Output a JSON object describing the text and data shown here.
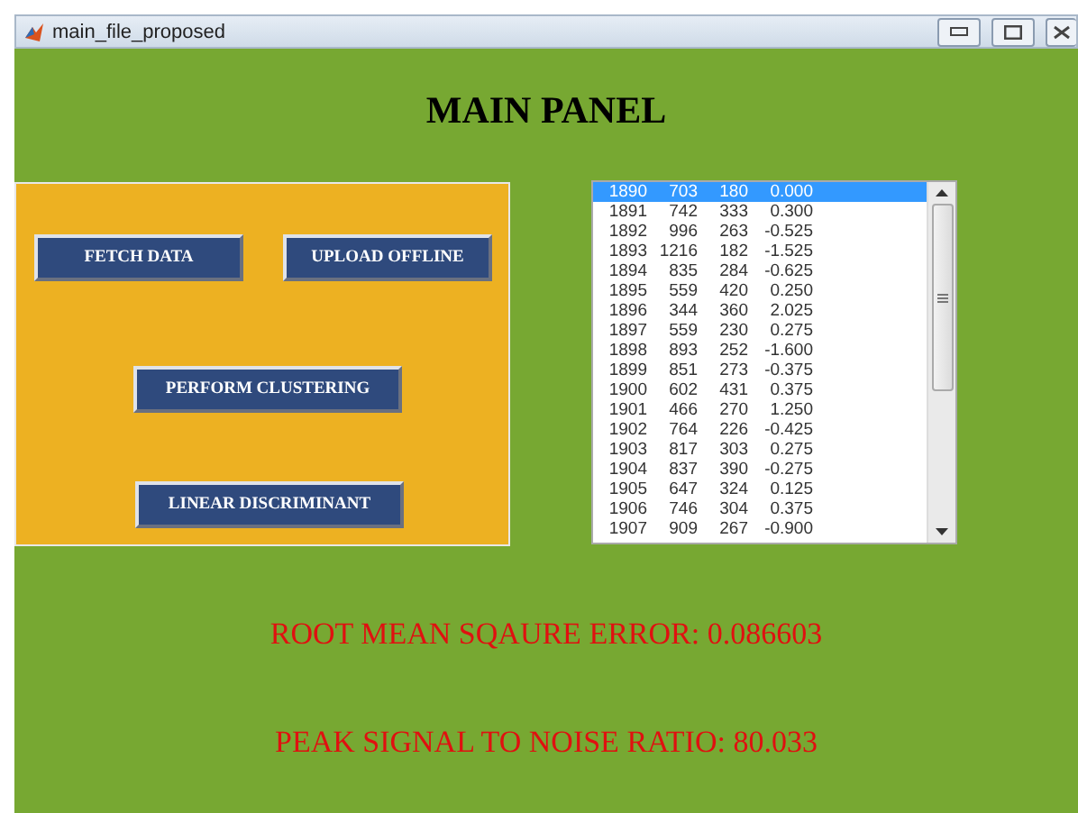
{
  "window": {
    "title": "main_file_proposed"
  },
  "heading": "MAIN PANEL",
  "buttons": [
    "FETCH DATA",
    "UPLOAD OFFLINE",
    "PERFORM CLUSTERING",
    "LINEAR DISCRIMINANT"
  ],
  "list": {
    "rows": [
      {
        "cells": [
          "1890",
          "703",
          "180",
          "0.000"
        ],
        "selected": true
      },
      {
        "cells": [
          "1891",
          "742",
          "333",
          "0.300"
        ],
        "selected": false
      },
      {
        "cells": [
          "1892",
          "996",
          "263",
          "-0.525"
        ],
        "selected": false
      },
      {
        "cells": [
          "1893",
          "1216",
          "182",
          "-1.525"
        ],
        "selected": false
      },
      {
        "cells": [
          "1894",
          "835",
          "284",
          "-0.625"
        ],
        "selected": false
      },
      {
        "cells": [
          "1895",
          "559",
          "420",
          "0.250"
        ],
        "selected": false
      },
      {
        "cells": [
          "1896",
          "344",
          "360",
          "2.025"
        ],
        "selected": false
      },
      {
        "cells": [
          "1897",
          "559",
          "230",
          "0.275"
        ],
        "selected": false
      },
      {
        "cells": [
          "1898",
          "893",
          "252",
          "-1.600"
        ],
        "selected": false
      },
      {
        "cells": [
          "1899",
          "851",
          "273",
          "-0.375"
        ],
        "selected": false
      },
      {
        "cells": [
          "1900",
          "602",
          "431",
          "0.375"
        ],
        "selected": false
      },
      {
        "cells": [
          "1901",
          "466",
          "270",
          "1.250"
        ],
        "selected": false
      },
      {
        "cells": [
          "1902",
          "764",
          "226",
          "-0.425"
        ],
        "selected": false
      },
      {
        "cells": [
          "1903",
          "817",
          "303",
          "0.275"
        ],
        "selected": false
      },
      {
        "cells": [
          "1904",
          "837",
          "390",
          "-0.275"
        ],
        "selected": false
      },
      {
        "cells": [
          "1905",
          "647",
          "324",
          "0.125"
        ],
        "selected": false
      },
      {
        "cells": [
          "1906",
          "746",
          "304",
          "0.375"
        ],
        "selected": false
      },
      {
        "cells": [
          "1907",
          "909",
          "267",
          "-0.900"
        ],
        "selected": false
      }
    ]
  },
  "results": [
    "ROOT MEAN SQAURE ERROR: 0.086603",
    "PEAK SIGNAL TO NOISE RATIO: 80.033"
  ]
}
